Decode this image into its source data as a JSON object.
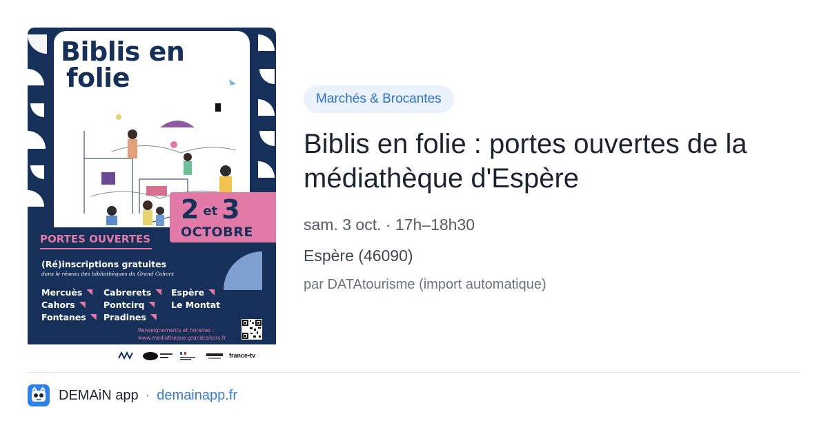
{
  "poster": {
    "title_line1": "Biblis en",
    "title_line2": "folie",
    "date_day1": "2",
    "date_et": "et",
    "date_day2": "3",
    "date_month": "OCTOBRE",
    "portes_ouvertes": "PORTES OUVERTES",
    "reinscriptions": "(Ré)inscriptions gratuites",
    "reinscriptions_sub": "dans le réseau des bibliothèques du Grand Cahors",
    "towns": [
      "Mercuès",
      "Cabrerets",
      "Espère",
      "Cahors",
      "Pontcirq",
      "Le Montat",
      "Fontanes",
      "Pradines"
    ],
    "info_line1": "Renseignements et horaires :",
    "info_line2": "www.mediatheque.grandcahors.fr",
    "logo_ftv": "france•tv",
    "colors": {
      "navy": "#163059",
      "pink": "#e27aa8",
      "light_blue": "#7e9fd0"
    }
  },
  "event": {
    "category": "Marchés & Brocantes",
    "title": "Biblis en folie : portes ouvertes de la médiathèque d'Espère",
    "datetime": "sam. 3 oct. · 17h–18h30",
    "location": "Espère (46090)",
    "source": "par DATAtourisme (import automatique)"
  },
  "footer": {
    "app_name": "DEMAiN app",
    "separator": "·",
    "url": "demainapp.fr",
    "app_icon": "app-logo-icon"
  },
  "colors": {
    "accent": "#2f6fd0",
    "category_bg": "#e9f1fb",
    "app_icon": "#2c82e8"
  }
}
